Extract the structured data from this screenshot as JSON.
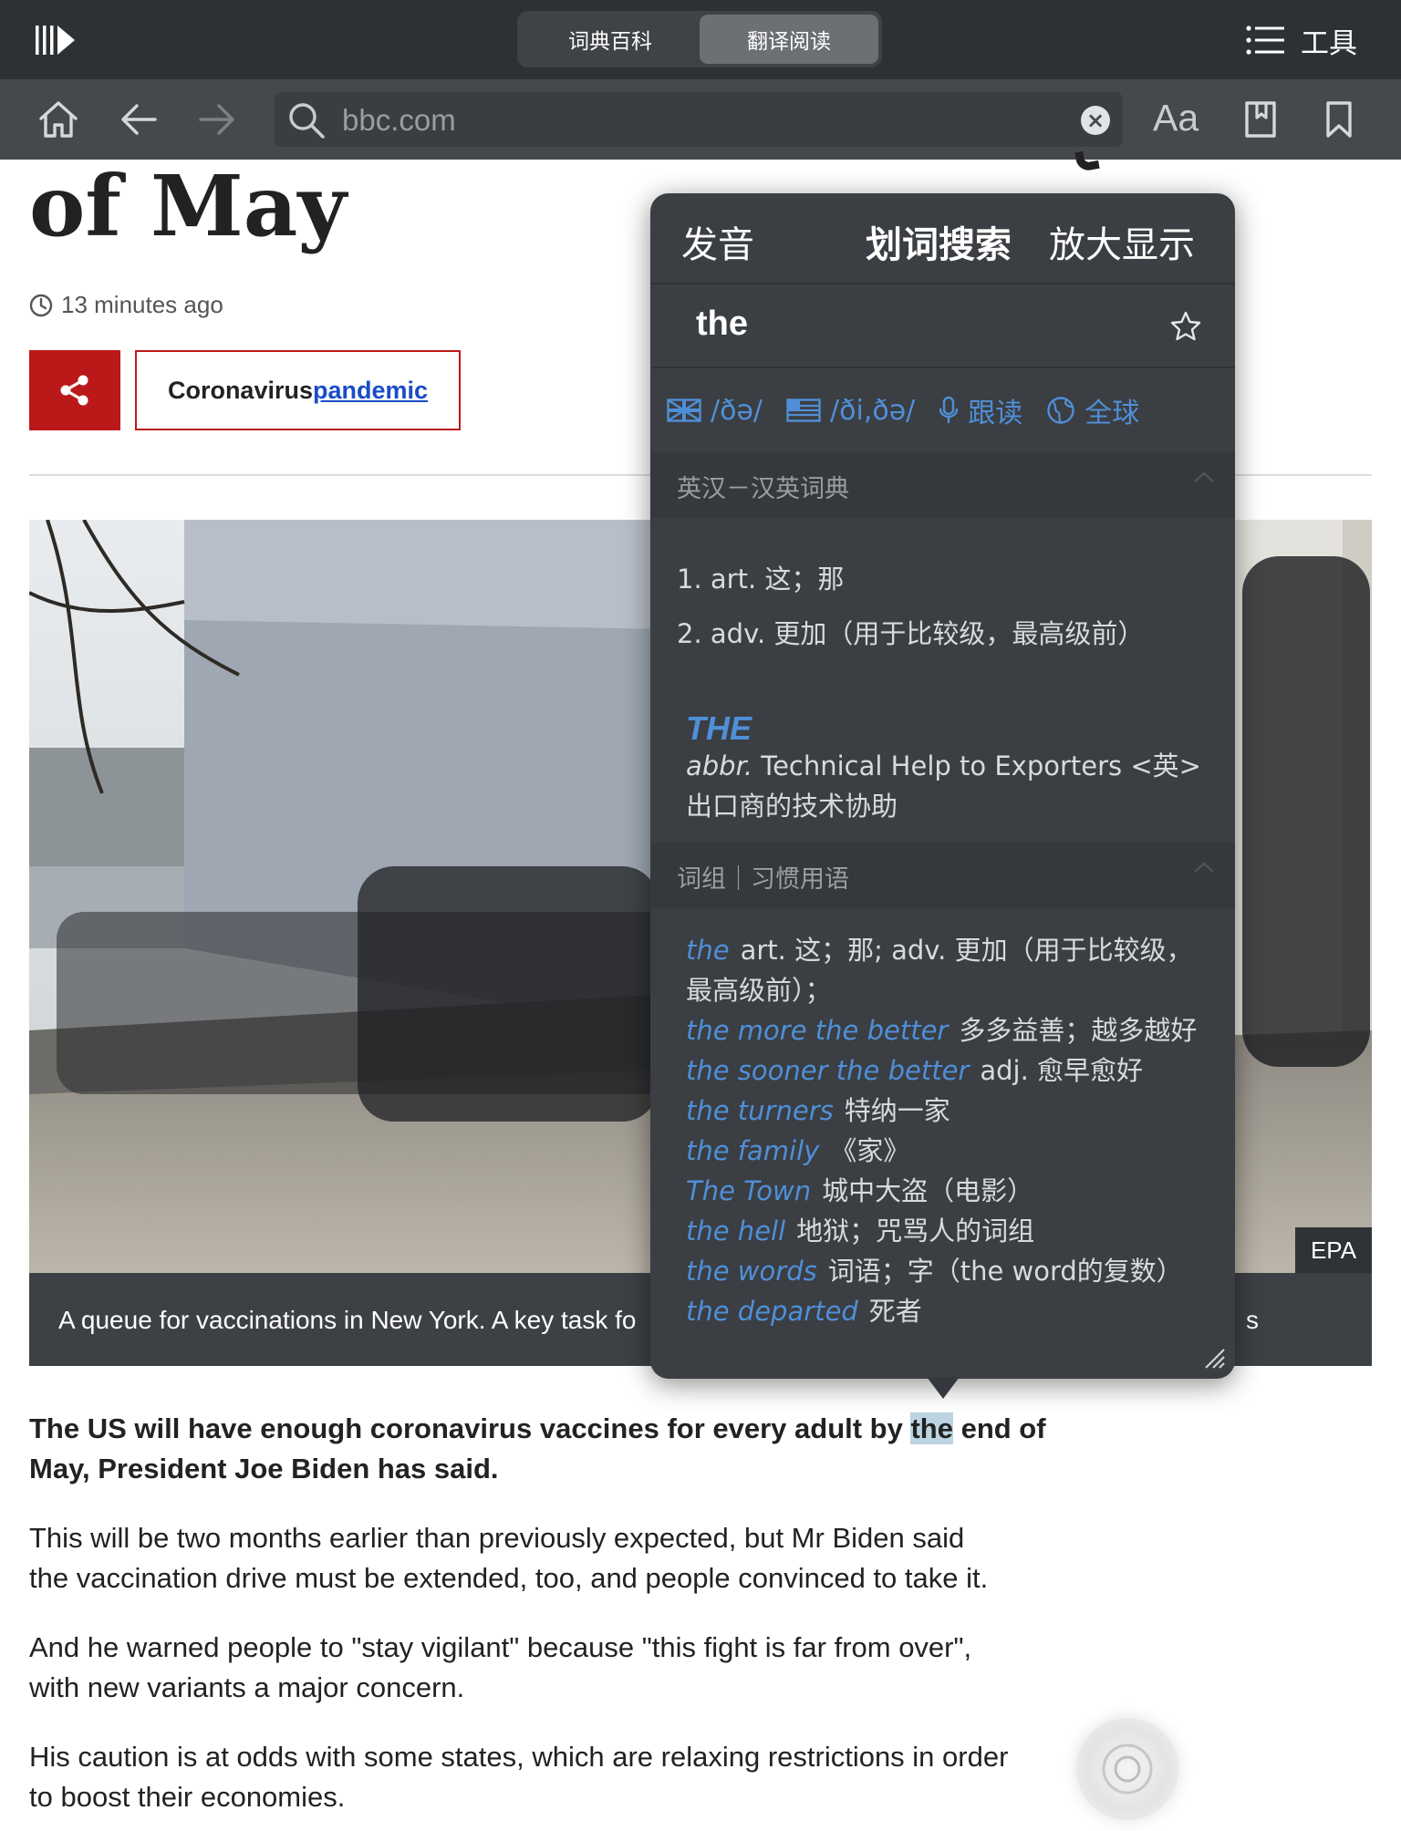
{
  "topbar": {
    "tabs": [
      {
        "label": "词典百科",
        "active": false
      },
      {
        "label": "翻译阅读",
        "active": true
      }
    ],
    "tools_label": "工具",
    "library_icon": "library-icon",
    "menu_icon": "list-menu-icon"
  },
  "nav": {
    "url": "bbc.com",
    "clear_glyph": "×",
    "font_size_label": "Aa",
    "icons": [
      "home-icon",
      "back-arrow-icon",
      "forward-arrow-icon",
      "search-icon",
      "clear-icon",
      "reading-list-icon",
      "bookmark-icon"
    ]
  },
  "article": {
    "headline_visible": "of May",
    "timestamp": "13 minutes ago",
    "tag": {
      "text": "Coronavirus",
      "link": "pandemic"
    },
    "image_credit": "EPA",
    "caption": "A queue for vaccinations in New York. A key task fo",
    "caption_tail": "s",
    "lead_before": "The US will have enough coronavirus vaccines for every adult by ",
    "lead_highlight": "the",
    "lead_after": " end of",
    "lead_line2": "May, President Joe Biden has said.",
    "paragraphs": [
      [
        "This will be two months earlier than previously expected, but Mr Biden said",
        "the vaccination drive must be extended, too, and people convinced to take it."
      ],
      [
        "And he warned people to \"stay vigilant\" because \"this fight is far from over\",",
        "with new variants a major concern."
      ],
      [
        "His caution is at odds with some states, which are relaxing restrictions in order",
        "to boost their economies."
      ]
    ]
  },
  "popup": {
    "tabs": [
      "发音",
      "划词搜索",
      "放大显示"
    ],
    "word": "the",
    "pron_uk": "/ðə/",
    "pron_us": "/ði,ðə/",
    "follow_read": "跟读",
    "global": "全球",
    "section_dict": "英汉－汉英词典",
    "definitions": [
      "1.  art. 这；那",
      "2.  adv. 更加（用于比较级，最高级前）"
    ],
    "abbr_title": "THE",
    "abbr_label": "abbr.",
    "abbr_text": " Technical Help to Exporters <英>出口商的技术协助",
    "section_phrases": "词组｜习惯用语",
    "phrases": [
      {
        "en": "the",
        "zh": "art. 这；那; adv. 更加（用于比较级，最高级前）；"
      },
      {
        "en": "the more the better",
        "zh": "多多益善；越多越好"
      },
      {
        "en": "the sooner the better",
        "zh": "adj. 愈早愈好"
      },
      {
        "en": "the turners",
        "zh": "特纳一家"
      },
      {
        "en": "the family",
        "zh": "《家》"
      },
      {
        "en": "The Town",
        "zh": "城中大盗（电影）"
      },
      {
        "en": "the hell",
        "zh": "地狱；咒骂人的词组"
      },
      {
        "en": "the words",
        "zh": "词语；字（the word的复数）"
      },
      {
        "en": "the departed",
        "zh": "死者"
      }
    ]
  },
  "colors": {
    "topbar": "#2d3034",
    "navbar": "#45484c",
    "bbc_red": "#bb1919",
    "link_blue": "#1a4cc8",
    "popup_bg": "#3b3e42",
    "popup_accent": "#4f8fd8",
    "highlight": "#bdd4e2"
  }
}
